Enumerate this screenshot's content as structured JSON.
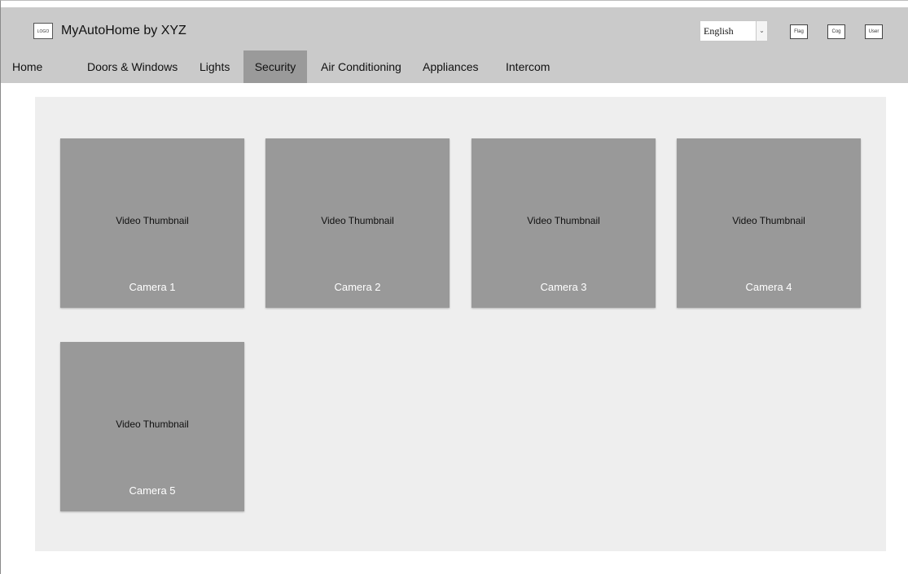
{
  "header": {
    "logo_text": "LOGO",
    "app_title": "MyAutoHome by XYZ",
    "language": {
      "selected": "English",
      "arrow": "⌄"
    },
    "flag_button": "Flag",
    "cog_button": "Cog",
    "user_button": "User"
  },
  "nav": {
    "active": "Security",
    "items": [
      {
        "label": "Home"
      },
      {
        "label": "Doors & Windows"
      },
      {
        "label": "Lights"
      },
      {
        "label": "Security"
      },
      {
        "label": "Air Conditioning"
      },
      {
        "label": "Appliances"
      },
      {
        "label": "Intercom"
      }
    ]
  },
  "cameras": [
    {
      "thumbnail": "Video Thumbnail",
      "name": "Camera 1"
    },
    {
      "thumbnail": "Video Thumbnail",
      "name": "Camera 2"
    },
    {
      "thumbnail": "Video Thumbnail",
      "name": "Camera 3"
    },
    {
      "thumbnail": "Video Thumbnail",
      "name": "Camera 4"
    },
    {
      "thumbnail": "Video Thumbnail",
      "name": "Camera 5"
    }
  ],
  "colors": {
    "header_bg": "#cacaca",
    "nav_active_bg": "#9a9a9a",
    "content_bg": "#eeeeee",
    "card_bg": "#999999"
  }
}
